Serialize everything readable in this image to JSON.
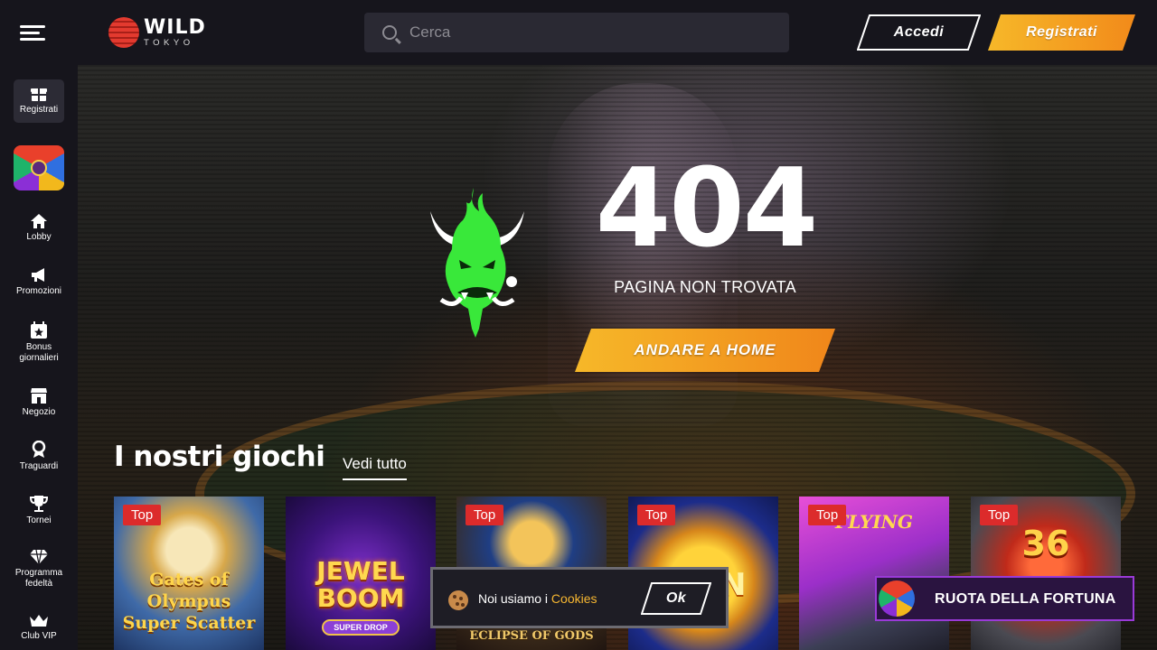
{
  "brand": {
    "name": "WILD",
    "sub": "TOKYO"
  },
  "search": {
    "placeholder": "Cerca"
  },
  "header": {
    "login_label": "Accedi",
    "register_label": "Registrati"
  },
  "sidebar": {
    "items": [
      {
        "label": "Registrati",
        "icon": "gift-icon"
      },
      {
        "label": "",
        "icon": "fortune-wheel-icon"
      },
      {
        "label": "Lobby",
        "icon": "home-icon"
      },
      {
        "label": "Promozioni",
        "icon": "megaphone-icon"
      },
      {
        "label": "Bonus giornalieri",
        "icon": "calendar-star-icon"
      },
      {
        "label": "Negozio",
        "icon": "shop-icon"
      },
      {
        "label": "Traguardi",
        "icon": "medal-icon"
      },
      {
        "label": "Tornei",
        "icon": "trophy-icon"
      },
      {
        "label": "Programma fedeltà",
        "icon": "diamond-icon"
      },
      {
        "label": "Club VIP",
        "icon": "crown-icon"
      }
    ]
  },
  "error": {
    "code": "404",
    "message": "PAGINA NON TROVATA",
    "home_button": "ANDARE A HOME"
  },
  "games": {
    "title": "I nostri giochi",
    "see_all": "Vedi tutto",
    "items": [
      {
        "name": "Gates of Olympus Super Scatter",
        "badge": "Top"
      },
      {
        "name": "JEWEL BOOM",
        "badge": "",
        "sub": "SUPER DROP"
      },
      {
        "name": "ECLIPSE OF GODS",
        "badge": "Top"
      },
      {
        "name": "COIN",
        "badge": "Top"
      },
      {
        "name": "FLYING",
        "badge": "Top"
      },
      {
        "name": "36",
        "badge": "Top"
      }
    ]
  },
  "cookie": {
    "text": "Noi usiamo i",
    "link": "Cookies",
    "ok": "Ok"
  },
  "wheel_banner": {
    "label": "RUOTA DELLA FORTUNA"
  },
  "colors": {
    "accent": "#f7a51e",
    "badge": "#dc2b2b",
    "neon_green": "#39e83a"
  }
}
